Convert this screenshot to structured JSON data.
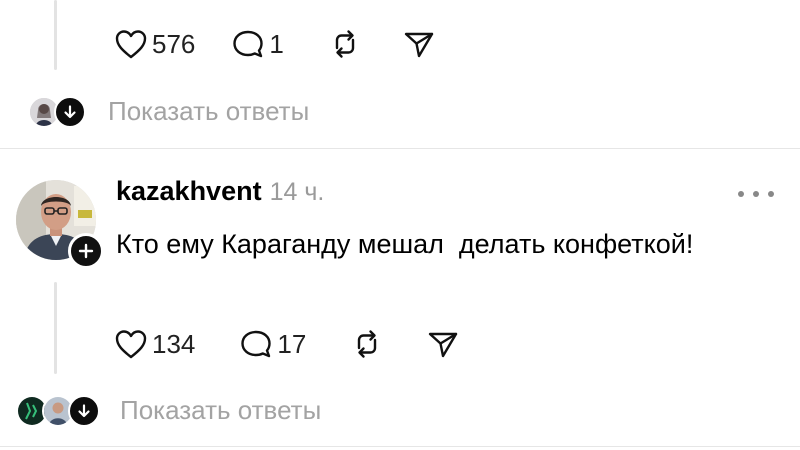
{
  "previous_post": {
    "likes": "576",
    "comments": "1",
    "show_replies": "Показать ответы"
  },
  "post": {
    "username": "kazakhvent",
    "timestamp": "14 ч.",
    "text": "Кто ему Караганду мешал  делать конфеткой!",
    "likes": "134",
    "comments": "17",
    "show_replies": "Показать ответы"
  },
  "icons": {
    "like": "heart-icon",
    "comment": "speech-bubble-icon",
    "repost": "repost-icon",
    "share": "paper-plane-icon",
    "more": "ellipsis-icon",
    "follow": "plus-icon",
    "expand": "arrow-down-icon"
  },
  "colors": {
    "text": "#000000",
    "muted": "#a3a3a3",
    "divider": "#e6e6e6",
    "badge": "#111111"
  }
}
